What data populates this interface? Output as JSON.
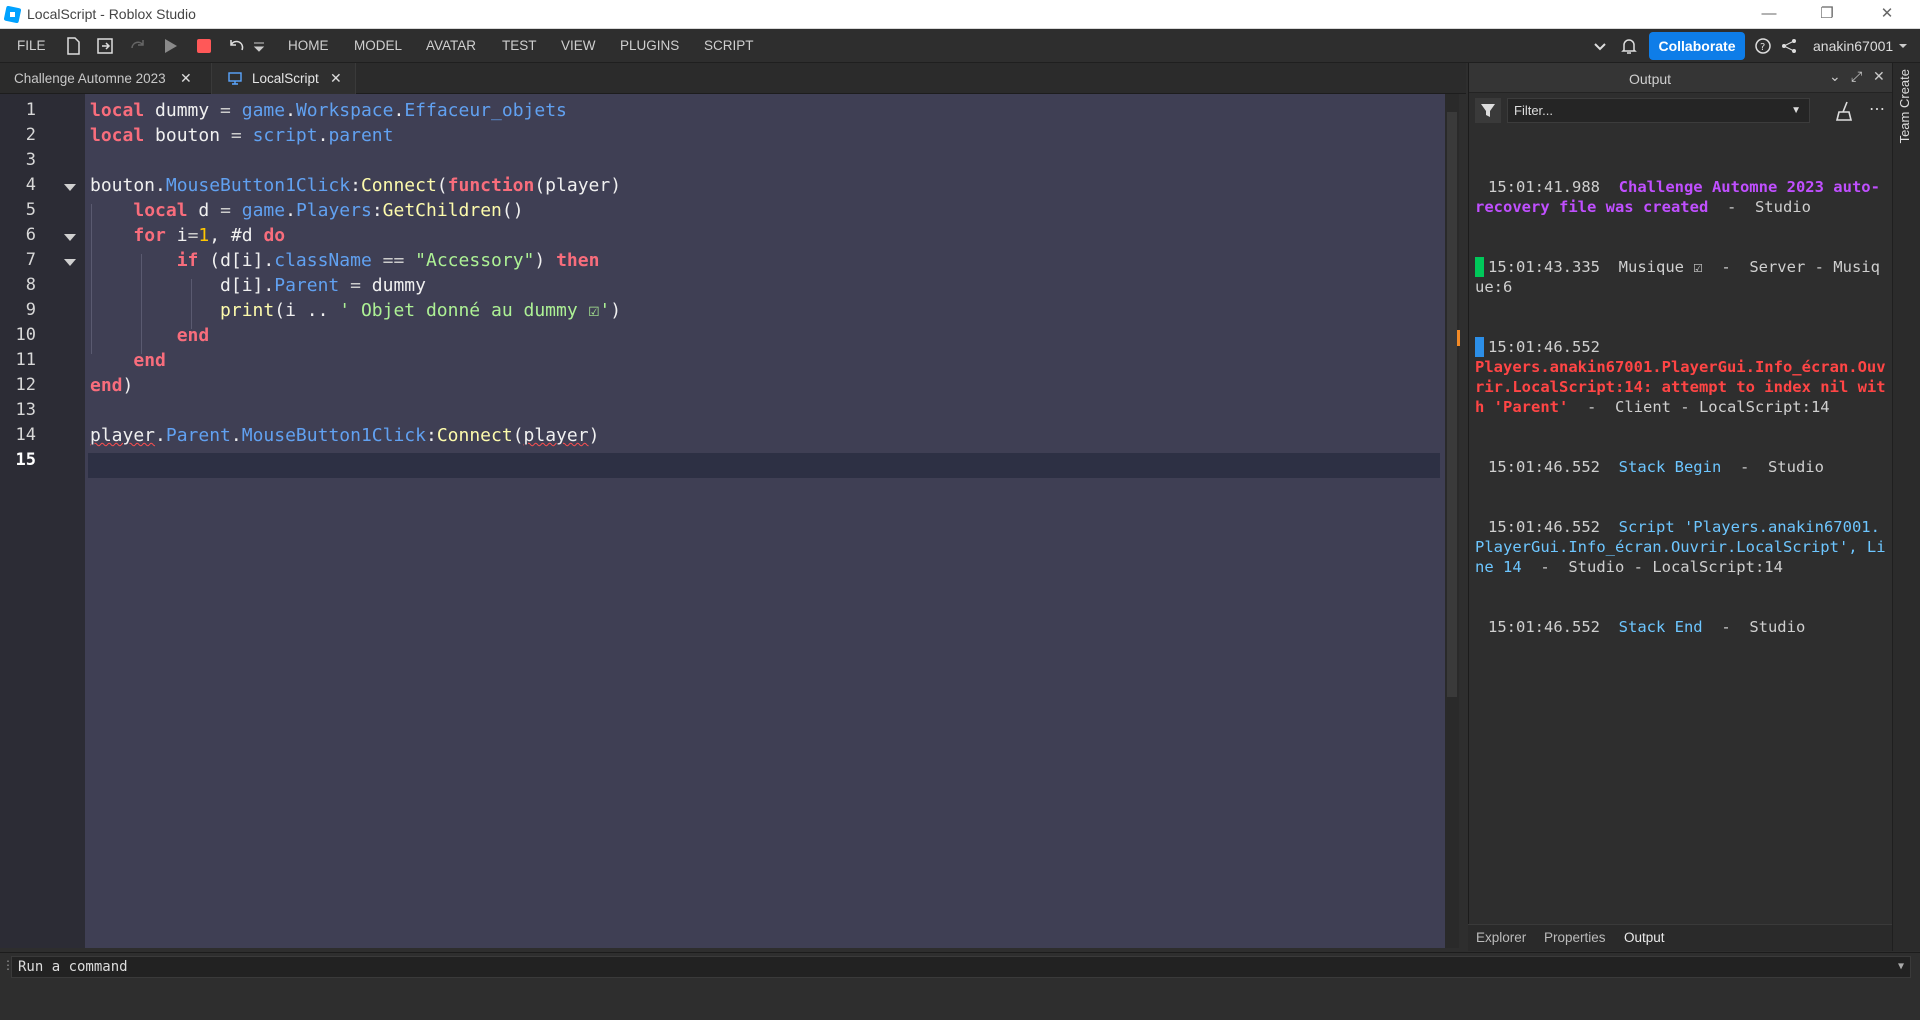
{
  "window": {
    "title": "LocalScript - Roblox Studio",
    "controls": [
      "—",
      "❐",
      "✕"
    ]
  },
  "menu": {
    "file": "FILE",
    "items": [
      "HOME",
      "MODEL",
      "AVATAR",
      "TEST",
      "VIEW",
      "PLUGINS",
      "SCRIPT"
    ],
    "collaborate": "Collaborate",
    "username": "anakin67001"
  },
  "tabs": [
    {
      "label": "Challenge Automne 2023"
    },
    {
      "label": "LocalScript"
    }
  ],
  "editor": {
    "line_numbers": [
      "1",
      "2",
      "3",
      "4",
      "5",
      "6",
      "7",
      "8",
      "9",
      "10",
      "11",
      "12",
      "13",
      "14",
      "15"
    ],
    "current_line": "15"
  },
  "output": {
    "title": "Output",
    "filter_placeholder": "Filter...",
    "logs": {
      "l1_time": "15:01:41.988",
      "l1_msg": "Challenge Automne 2023 auto-recovery file was created",
      "l1_src": "  -  Studio",
      "l2_time": "15:01:43.335",
      "l2_msg": "Musique ☑",
      "l2_src": "  -  Server - Musique:6",
      "l3_time": "15:01:46.552",
      "l3_msg": "Players.anakin67001.PlayerGui.Info_écran.Ouvrir.LocalScript:14: attempt to index nil with 'Parent'",
      "l3_src": "  -  Client - LocalScript:14",
      "l4_time": "15:01:46.552",
      "l4_msg": "Stack Begin",
      "l4_src": "  -  Studio",
      "l5_time": "15:01:46.552",
      "l5_msg": "Script 'Players.anakin67001.PlayerGui.Info_écran.Ouvrir.LocalScript', Line 14",
      "l5_src": "  -  Studio - LocalScript:14",
      "l6_time": "15:01:46.552",
      "l6_msg": "Stack End",
      "l6_src": "  -  Studio"
    }
  },
  "panel_tabs": [
    "Explorer",
    "Properties",
    "Output"
  ],
  "side_strip": "Team Create",
  "command_bar": {
    "placeholder": "Run a command"
  },
  "colors": {
    "keyword": "#f86d7c",
    "property": "#61a1f1",
    "string": "#adf195",
    "number": "#ffc600",
    "function": "#fdfbac",
    "accent": "#0e7de8"
  }
}
